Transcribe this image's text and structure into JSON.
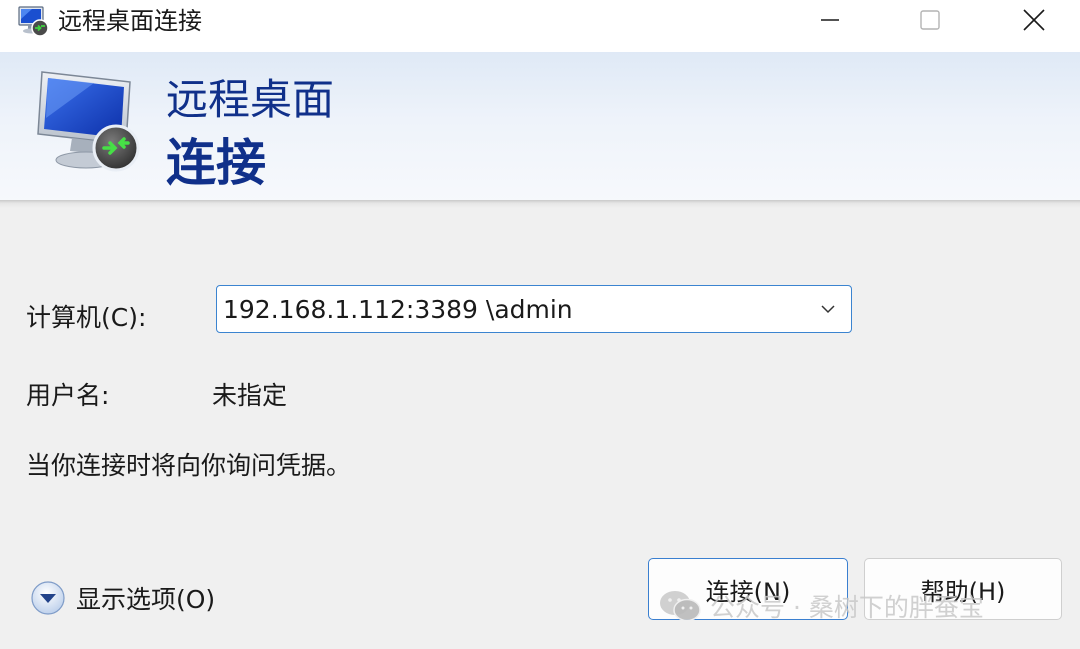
{
  "window": {
    "title": "远程桌面连接"
  },
  "banner": {
    "line1": "远程桌面",
    "line2": "连接",
    "accent_color": "#10308a"
  },
  "form": {
    "computer_label": "计算机(C):",
    "computer_value": "192.168.1.112:3389 \\admin",
    "username_label": "用户名:",
    "username_value": "未指定",
    "info_text": "当你连接时将向你询问凭据。"
  },
  "options": {
    "label": "显示选项(O)"
  },
  "buttons": {
    "connect_label": "连接(N)",
    "help_label": "帮助(H)"
  },
  "watermark": {
    "text": "公众号 · 桑树下的胖蚕宝"
  },
  "icons": {
    "app": "remote-desktop-icon",
    "minimize": "minimize-icon",
    "maximize": "maximize-icon",
    "close": "close-icon",
    "dropdown": "chevron-down-icon",
    "options": "expand-circle-icon",
    "watermark": "wechat-icon"
  }
}
